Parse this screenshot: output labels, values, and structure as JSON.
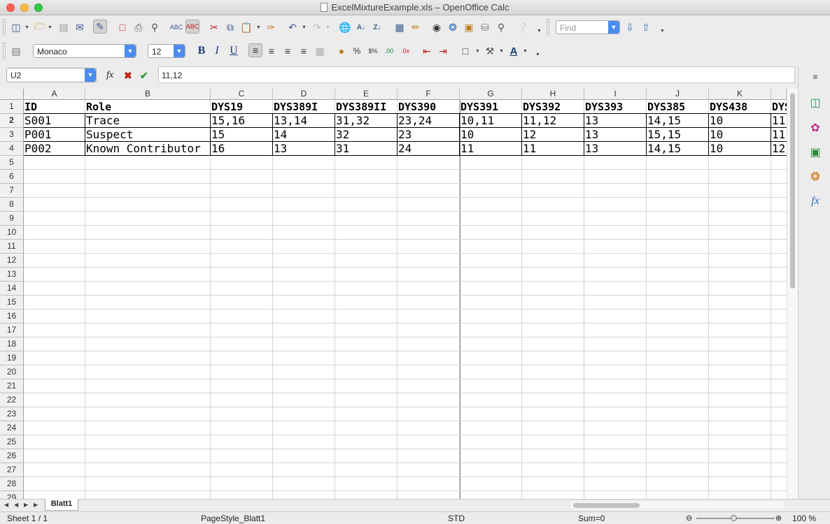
{
  "window": {
    "title": "ExcelMixtureExample.xls – OpenOffice Calc"
  },
  "toolbar": {
    "find_placeholder": "Find",
    "font_name": "Monaco",
    "font_size": "12",
    "icons": [
      "new-document",
      "open",
      "save",
      "email",
      "edit-file",
      "export-pdf",
      "print",
      "page-preview",
      "spellcheck",
      "autospellcheck",
      "cut",
      "copy",
      "paste",
      "clone-formatting",
      "undo",
      "redo",
      "hyperlink",
      "sort-ascending",
      "sort-descending",
      "chart",
      "drawing",
      "navigator",
      "gallery",
      "data-sources",
      "zoom",
      "help"
    ]
  },
  "format_bar": {
    "bold": "B",
    "italic": "I",
    "underline": "U"
  },
  "formula_bar": {
    "cell_ref": "U2",
    "value": "11,12"
  },
  "sheet": {
    "columns": [
      "A",
      "B",
      "C",
      "D",
      "E",
      "F",
      "G",
      "H",
      "I",
      "J",
      "K"
    ],
    "rows": [
      [
        "ID",
        "Role",
        "DYS19",
        "DYS389I",
        "DYS389II",
        "DYS390",
        "DYS391",
        "DYS392",
        "DYS393",
        "DYS385",
        "DYS438",
        "DYS"
      ],
      [
        "S001",
        "Trace",
        "15,16",
        "13,14",
        "31,32",
        "23,24",
        "10,11",
        "11,12",
        "13",
        "14,15",
        "10",
        "11"
      ],
      [
        "P001",
        "Suspect",
        "15",
        "14",
        "32",
        "23",
        "10",
        "12",
        "13",
        "15,15",
        "10",
        "11"
      ],
      [
        "P002",
        "Known Contributor",
        "16",
        "13",
        "31",
        "24",
        "11",
        "11",
        "13",
        "14,15",
        "10",
        "12"
      ]
    ],
    "row_numbers": [
      "1",
      "2",
      "3",
      "4",
      "5",
      "6",
      "7",
      "8",
      "9",
      "10",
      "11",
      "12",
      "13",
      "14",
      "15",
      "16",
      "17",
      "18",
      "19",
      "20",
      "21",
      "22",
      "23",
      "24",
      "25",
      "26",
      "27",
      "28",
      "29"
    ],
    "tab_name": "Blatt1"
  },
  "status": {
    "sheet": "Sheet 1 / 1",
    "page_style": "PageStyle_Blatt1",
    "mode": "STD",
    "sum": "Sum=0",
    "zoom": "100 %"
  }
}
